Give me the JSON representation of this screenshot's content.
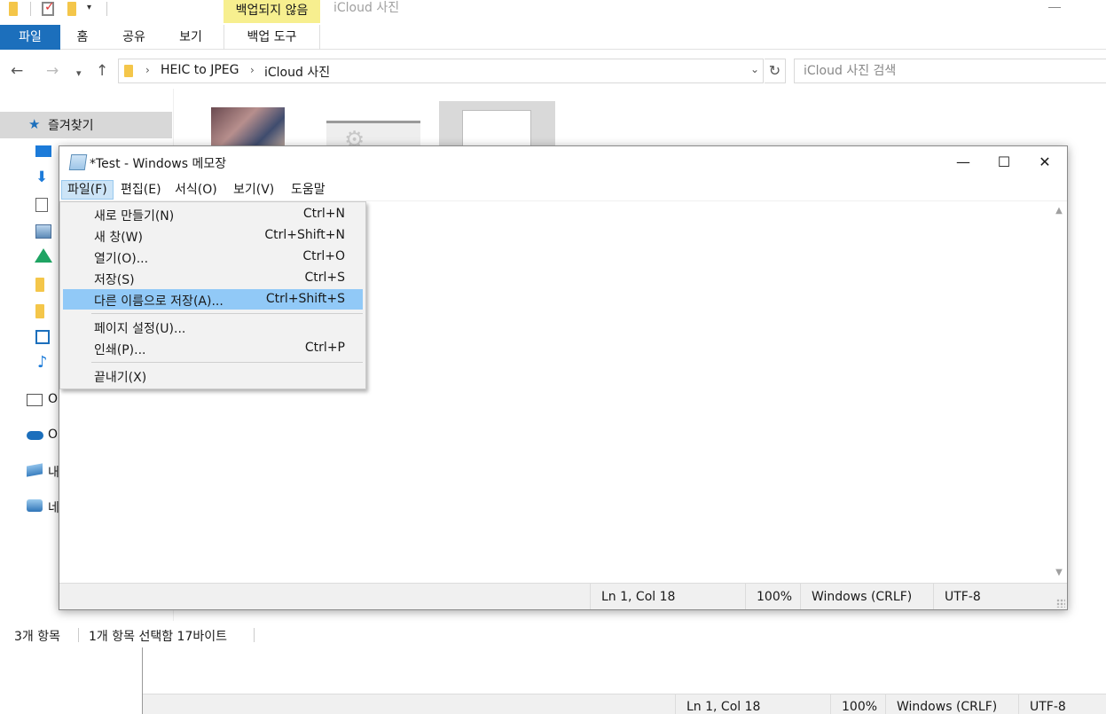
{
  "explorer": {
    "context_tab": "백업되지 않음",
    "window_title": "iCloud 사진",
    "ribbon_tabs": [
      "파일",
      "홈",
      "공유",
      "보기"
    ],
    "context_subtab": "백업 도구",
    "breadcrumbs": [
      "HEIC to JPEG",
      "iCloud 사진"
    ],
    "search_placeholder": "iCloud 사진 검색",
    "favorites_label": "즐겨찾기",
    "sidebar_partials": [
      "O",
      "O",
      "내",
      "네"
    ],
    "status_count": "3개 항목",
    "status_selection": "1개 항목 선택함 17바이트"
  },
  "notepad": {
    "title": "*Test - Windows 메모장",
    "menus": [
      "파일(F)",
      "편집(E)",
      "서식(O)",
      "보기(V)",
      "도움말"
    ],
    "status": {
      "position": "Ln 1, Col 18",
      "zoom": "100%",
      "line_ending": "Windows (CRLF)",
      "encoding": "UTF-8"
    }
  },
  "file_menu": {
    "items": [
      {
        "label": "새로 만들기(N)",
        "shortcut": "Ctrl+N"
      },
      {
        "label": "새 창(W)",
        "shortcut": "Ctrl+Shift+N"
      },
      {
        "label": "열기(O)...",
        "shortcut": "Ctrl+O"
      },
      {
        "label": "저장(S)",
        "shortcut": "Ctrl+S"
      },
      {
        "label": "다른 이름으로 저장(A)...",
        "shortcut": "Ctrl+Shift+S"
      },
      {
        "label": "페이지 설정(U)...",
        "shortcut": ""
      },
      {
        "label": "인쇄(P)...",
        "shortcut": "Ctrl+P"
      },
      {
        "label": "끝내기(X)",
        "shortcut": ""
      }
    ],
    "highlighted_index": 4
  },
  "bg_notepad": {
    "status": {
      "position": "Ln 1, Col 18",
      "zoom": "100%",
      "line_ending": "Windows (CRLF)",
      "encoding": "UTF-8"
    }
  },
  "colors": {
    "file_tab": "#1c6fbc",
    "context_tab": "#f7ef8f",
    "menu_highlight": "#91c9f7",
    "menu_open": "#cce4f7"
  },
  "icons": [
    "folder-icon",
    "checkbox-icon",
    "star-icon",
    "desktop-icon",
    "download-icon",
    "document-icon",
    "picture-icon",
    "drive-icon",
    "music-icon",
    "onedrive-icon",
    "pc-icon",
    "network-icon",
    "notepad-icon",
    "refresh-icon",
    "search-icon"
  ]
}
